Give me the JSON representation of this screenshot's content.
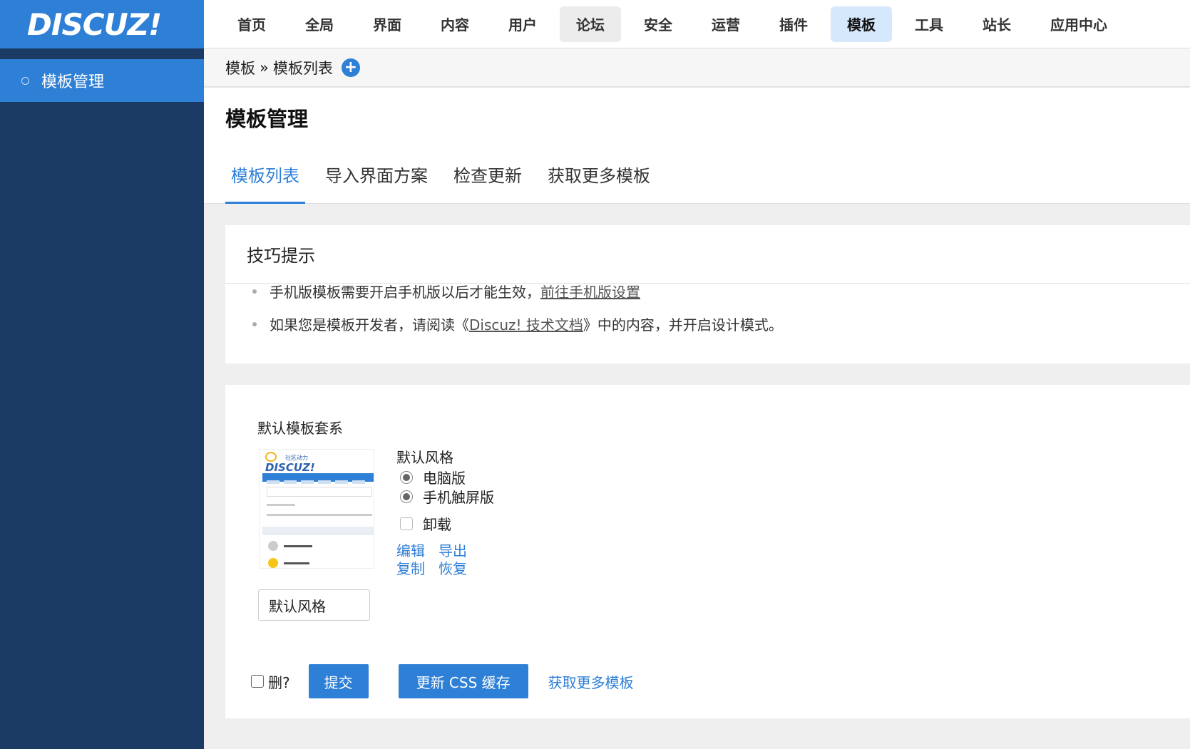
{
  "logo": "DISCUZ!",
  "sidebar": {
    "items": [
      {
        "label": "模板管理"
      }
    ]
  },
  "nav": {
    "items": [
      {
        "label": "首页"
      },
      {
        "label": "全局"
      },
      {
        "label": "界面"
      },
      {
        "label": "内容"
      },
      {
        "label": "用户"
      },
      {
        "label": "论坛"
      },
      {
        "label": "安全"
      },
      {
        "label": "运营"
      },
      {
        "label": "插件"
      },
      {
        "label": "模板"
      },
      {
        "label": "工具"
      },
      {
        "label": "站长"
      },
      {
        "label": "应用中心"
      }
    ],
    "hover": "论坛",
    "active": "模板"
  },
  "breadcrumb": {
    "root": "模板",
    "sep": "»",
    "current": "模板列表"
  },
  "page": {
    "title": "模板管理"
  },
  "tabs": [
    {
      "label": "模板列表"
    },
    {
      "label": "导入界面方案"
    },
    {
      "label": "检查更新"
    },
    {
      "label": "获取更多模板"
    }
  ],
  "tips": {
    "title": "技巧提示",
    "line1_text": "手机版模板需要开启手机版以后才能生效，",
    "line1_link": "前往手机版设置",
    "line2_pre": "如果您是模板开发者，请阅读《",
    "line2_link": "Discuz! 技术文档",
    "line2_post": "》中的内容，并开启设计模式。"
  },
  "template": {
    "set_label": "默认模板套系",
    "thumb_sub": "社区动力",
    "thumb_logo": "DISCUZ!",
    "style_title": "默认风格",
    "radio_pc": "电脑版",
    "radio_mobile": "手机触屏版",
    "uninstall": "卸载",
    "links": {
      "edit": "编辑",
      "export": "导出",
      "copy": "复制",
      "restore": "恢复"
    },
    "name_value": "默认风格"
  },
  "footer": {
    "delete_label": "删?",
    "submit": "提交",
    "update_css": "更新 CSS 缓存",
    "more": "获取更多模板"
  }
}
